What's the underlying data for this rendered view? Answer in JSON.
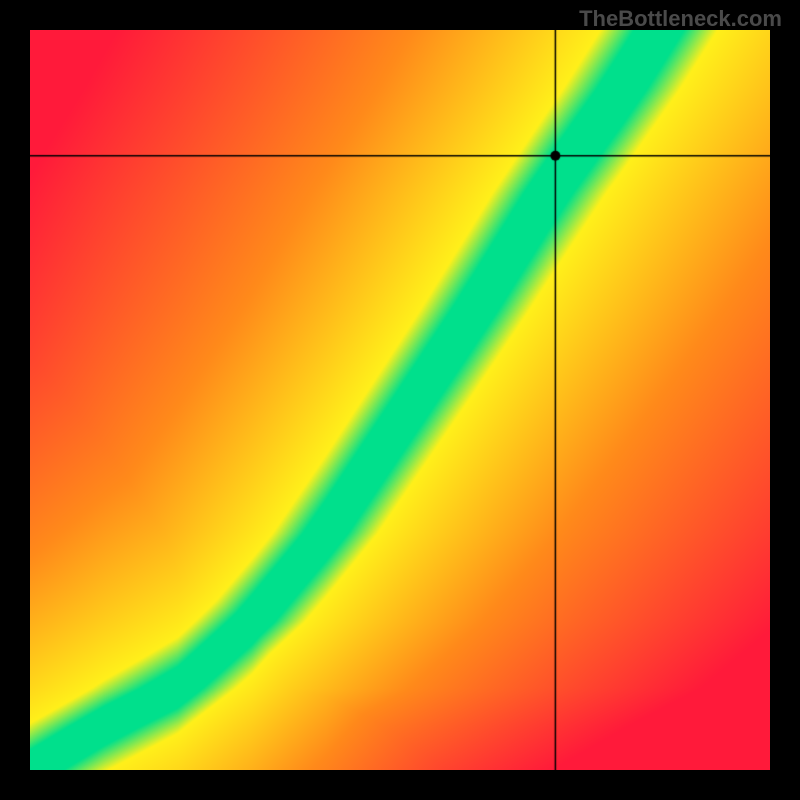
{
  "watermark": "TheBottleneck.com",
  "chart_data": {
    "type": "heatmap",
    "title": "",
    "xlabel": "",
    "ylabel": "",
    "xlim": [
      0,
      1
    ],
    "ylim": [
      0,
      1
    ],
    "crosshair": {
      "x": 0.71,
      "y": 0.83
    },
    "marker": {
      "x": 0.71,
      "y": 0.83,
      "radius": 5,
      "color": "#000000"
    },
    "colors": {
      "red": "#ff1a3a",
      "orange": "#ff8a1a",
      "yellow": "#fff01a",
      "green": "#00e08c"
    },
    "ridge": {
      "description": "Region of optimal balance (green) following a curve from bottom-left to upper-right; brightness decreases to yellow, orange, red as distance from the ridge increases.",
      "points": [
        {
          "x": 0.0,
          "y": 0.0
        },
        {
          "x": 0.1,
          "y": 0.06
        },
        {
          "x": 0.2,
          "y": 0.11
        },
        {
          "x": 0.3,
          "y": 0.2
        },
        {
          "x": 0.4,
          "y": 0.32
        },
        {
          "x": 0.5,
          "y": 0.47
        },
        {
          "x": 0.6,
          "y": 0.62
        },
        {
          "x": 0.7,
          "y": 0.78
        },
        {
          "x": 0.8,
          "y": 0.92
        },
        {
          "x": 0.85,
          "y": 1.0
        }
      ],
      "half_width": 0.035
    }
  }
}
